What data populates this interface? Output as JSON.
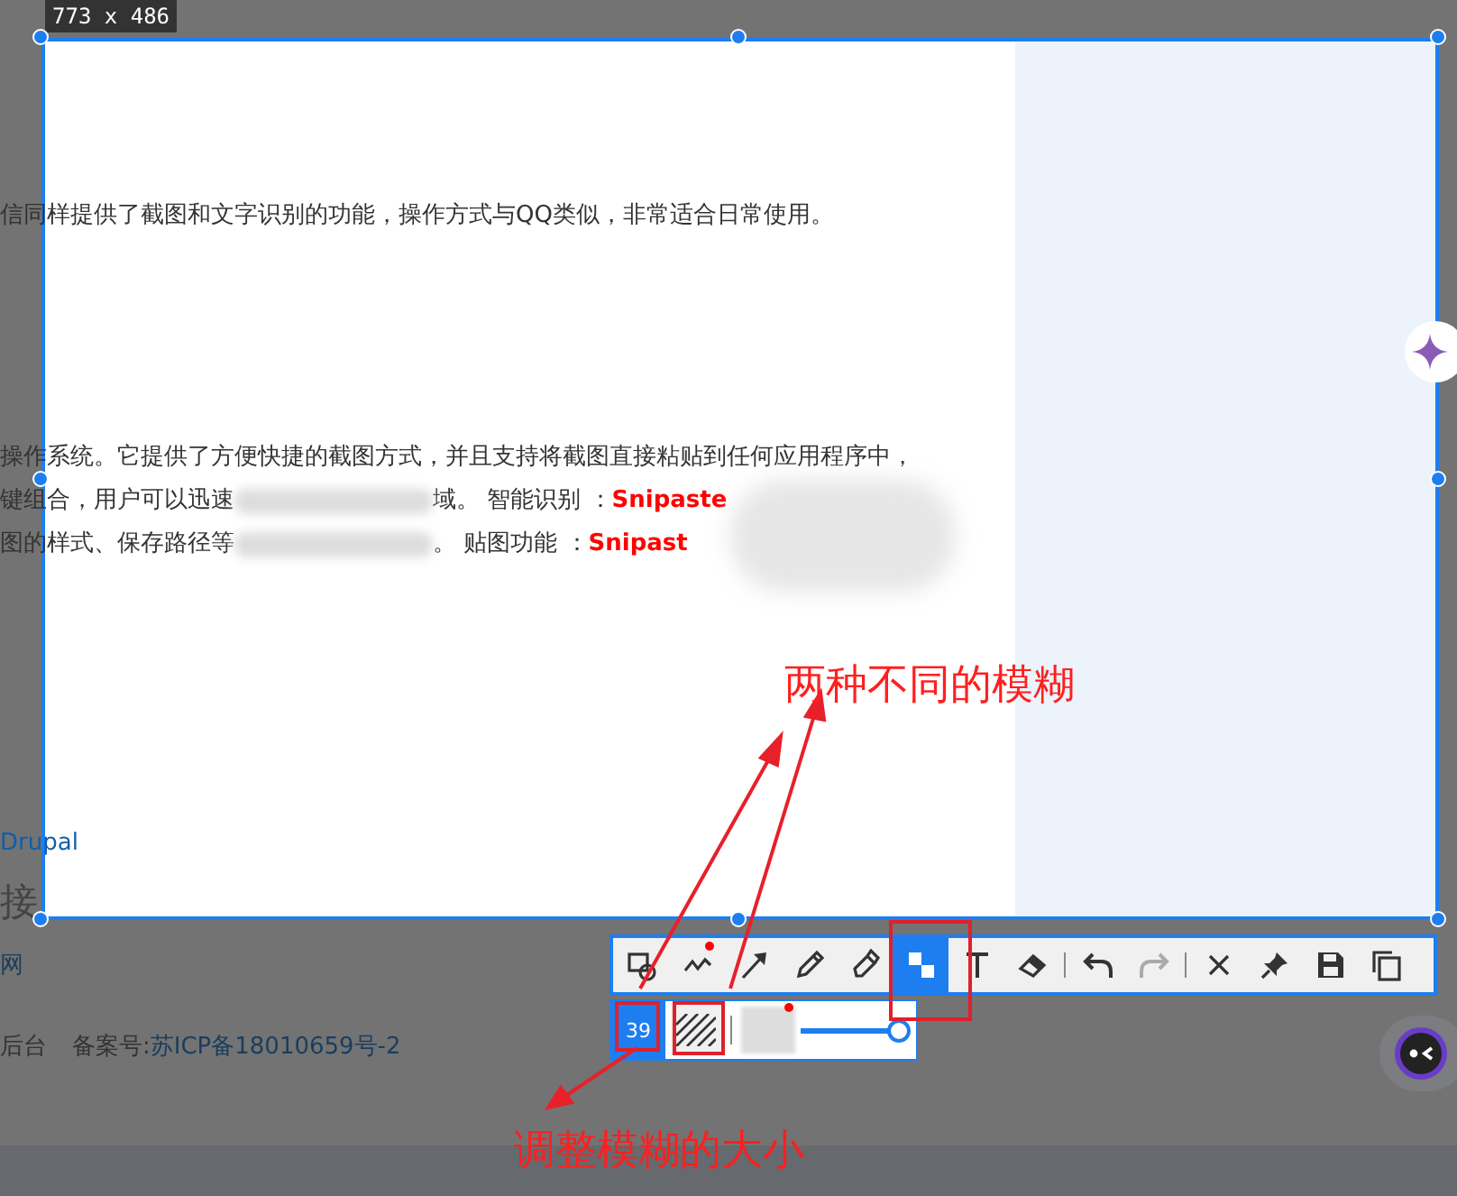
{
  "size_label": "773 x 486",
  "article": [
    [
      {
        "kind": "text",
        "text": "信同样提供了截图和文字识别的功能，操作方式与QQ类似，非常适合日常使用。"
      }
    ],
    [
      {
        "kind": "text",
        "text": "操作系统。它提供了方便快捷的截图方式，并且支持将截图直接粘贴到任何应用程序中，"
      }
    ],
    [
      {
        "kind": "text",
        "text": "键组合，用户可以迅速"
      },
      {
        "kind": "blurred"
      },
      {
        "kind": "text",
        "text": "域。 智能识别 ："
      },
      {
        "kind": "highlight",
        "text": "Snipaste"
      }
    ],
    [
      {
        "kind": "text",
        "text": "图的样式、保存路径等"
      },
      {
        "kind": "blurred"
      },
      {
        "kind": "text",
        "text": "。 贴图功能 ："
      },
      {
        "kind": "highlight",
        "text": "Snipast"
      }
    ]
  ],
  "footer": {
    "link": "Drupal",
    "heading": "接",
    "link_2": "网",
    "admin": "后台",
    "record_label": "备案号:",
    "record_link": "苏ICP备18010659号-2"
  },
  "toolbar": [
    {
      "kind": "shape",
      "selected": false,
      "dot": false
    },
    {
      "kind": "polyline",
      "selected": false,
      "dot": true
    },
    {
      "kind": "arrow",
      "selected": false,
      "dot": false
    },
    {
      "kind": "pencil",
      "selected": false,
      "dot": false
    },
    {
      "kind": "marker",
      "selected": false,
      "dot": false
    },
    {
      "kind": "mosaic",
      "selected": true,
      "dot": false
    },
    {
      "kind": "text",
      "selected": false,
      "dot": false
    },
    {
      "kind": "eraser",
      "selected": false,
      "dot": false
    },
    {
      "kind": "divider"
    },
    {
      "kind": "undo",
      "disabled": false
    },
    {
      "kind": "redo",
      "disabled": true
    },
    {
      "kind": "divider"
    },
    {
      "kind": "close",
      "disabled": false
    },
    {
      "kind": "pin",
      "disabled": false
    },
    {
      "kind": "save",
      "disabled": false
    },
    {
      "kind": "copy",
      "disabled": false
    }
  ],
  "blur_panel": {
    "size": "39",
    "style": {
      "kind": "hatch"
    },
    "swatch_dot": true,
    "slider": {
      "level": 1
    }
  },
  "annotations": [
    {
      "text": "两种不同的模糊"
    },
    {
      "text": "调整模糊的大小"
    }
  ]
}
